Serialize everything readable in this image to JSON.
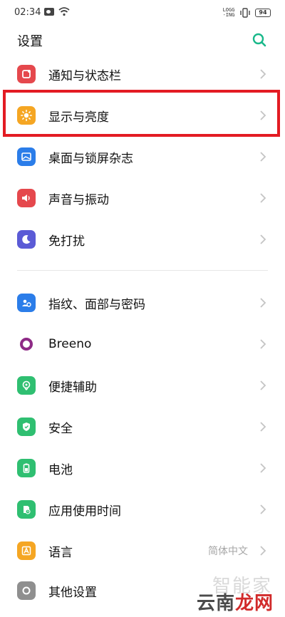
{
  "status_bar": {
    "time": "02:34",
    "network_label": "LOGG -ING",
    "battery": "94"
  },
  "header": {
    "title": "设置"
  },
  "settings": [
    {
      "label": "通知与状态栏",
      "icon": "notification-icon",
      "color": "#e5484d"
    },
    {
      "label": "显示与亮度",
      "icon": "brightness-icon",
      "color": "#f5a623"
    },
    {
      "label": "桌面与锁屏杂志",
      "icon": "wallpaper-icon",
      "color": "#2b7de9"
    },
    {
      "label": "声音与振动",
      "icon": "sound-icon",
      "color": "#e5484d"
    },
    {
      "label": "免打扰",
      "icon": "moon-icon",
      "color": "#5b5bd6"
    },
    {
      "label": "指纹、面部与密码",
      "icon": "fingerprint-icon",
      "color": "#2b7de9"
    },
    {
      "label": "Breeno",
      "icon": "breeno-icon",
      "color": "#8e2a86"
    },
    {
      "label": "便捷辅助",
      "icon": "assist-icon",
      "color": "#2fbf71"
    },
    {
      "label": "安全",
      "icon": "shield-icon",
      "color": "#2fbf71"
    },
    {
      "label": "电池",
      "icon": "battery-icon",
      "color": "#2fbf71"
    },
    {
      "label": "应用使用时间",
      "icon": "app-time-icon",
      "color": "#2fbf71"
    },
    {
      "label": "语言",
      "icon": "language-icon",
      "color": "#f5a623",
      "value": "简体中文"
    },
    {
      "label": "其他设置",
      "icon": "more-settings-icon",
      "color": "#8f8f8f"
    }
  ],
  "watermark": {
    "top": "智能家",
    "bottom_a": "云南",
    "bottom_b": "龙网"
  },
  "colors": {
    "highlight": "#e31b23",
    "accent_search": "#19b88a"
  }
}
